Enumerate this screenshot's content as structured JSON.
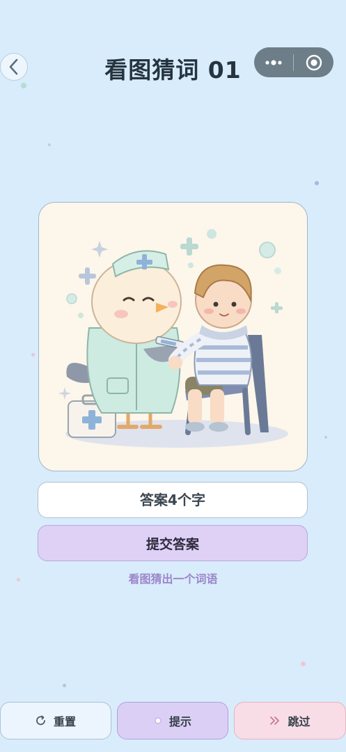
{
  "header": {
    "title": "看图猜词 01"
  },
  "answer": {
    "placeholder": "答案4个字"
  },
  "submit": {
    "label": "提交答案"
  },
  "instruction": "看图猜出一个词语",
  "footer": {
    "reset_label": "重置",
    "hint_label": "提示",
    "skip_label": "跳过"
  },
  "colors": {
    "background": "#d8ecfb",
    "submit": "#dfd1f6",
    "skip": "#f9dde6",
    "instruction": "#9b85c8"
  },
  "icons": {
    "back": "chevron-left-icon",
    "more": "more-dots-icon",
    "close": "target-close-icon",
    "reset": "refresh-icon",
    "hint": "bulb-dot-icon",
    "skip": "double-chevron-right-icon"
  }
}
